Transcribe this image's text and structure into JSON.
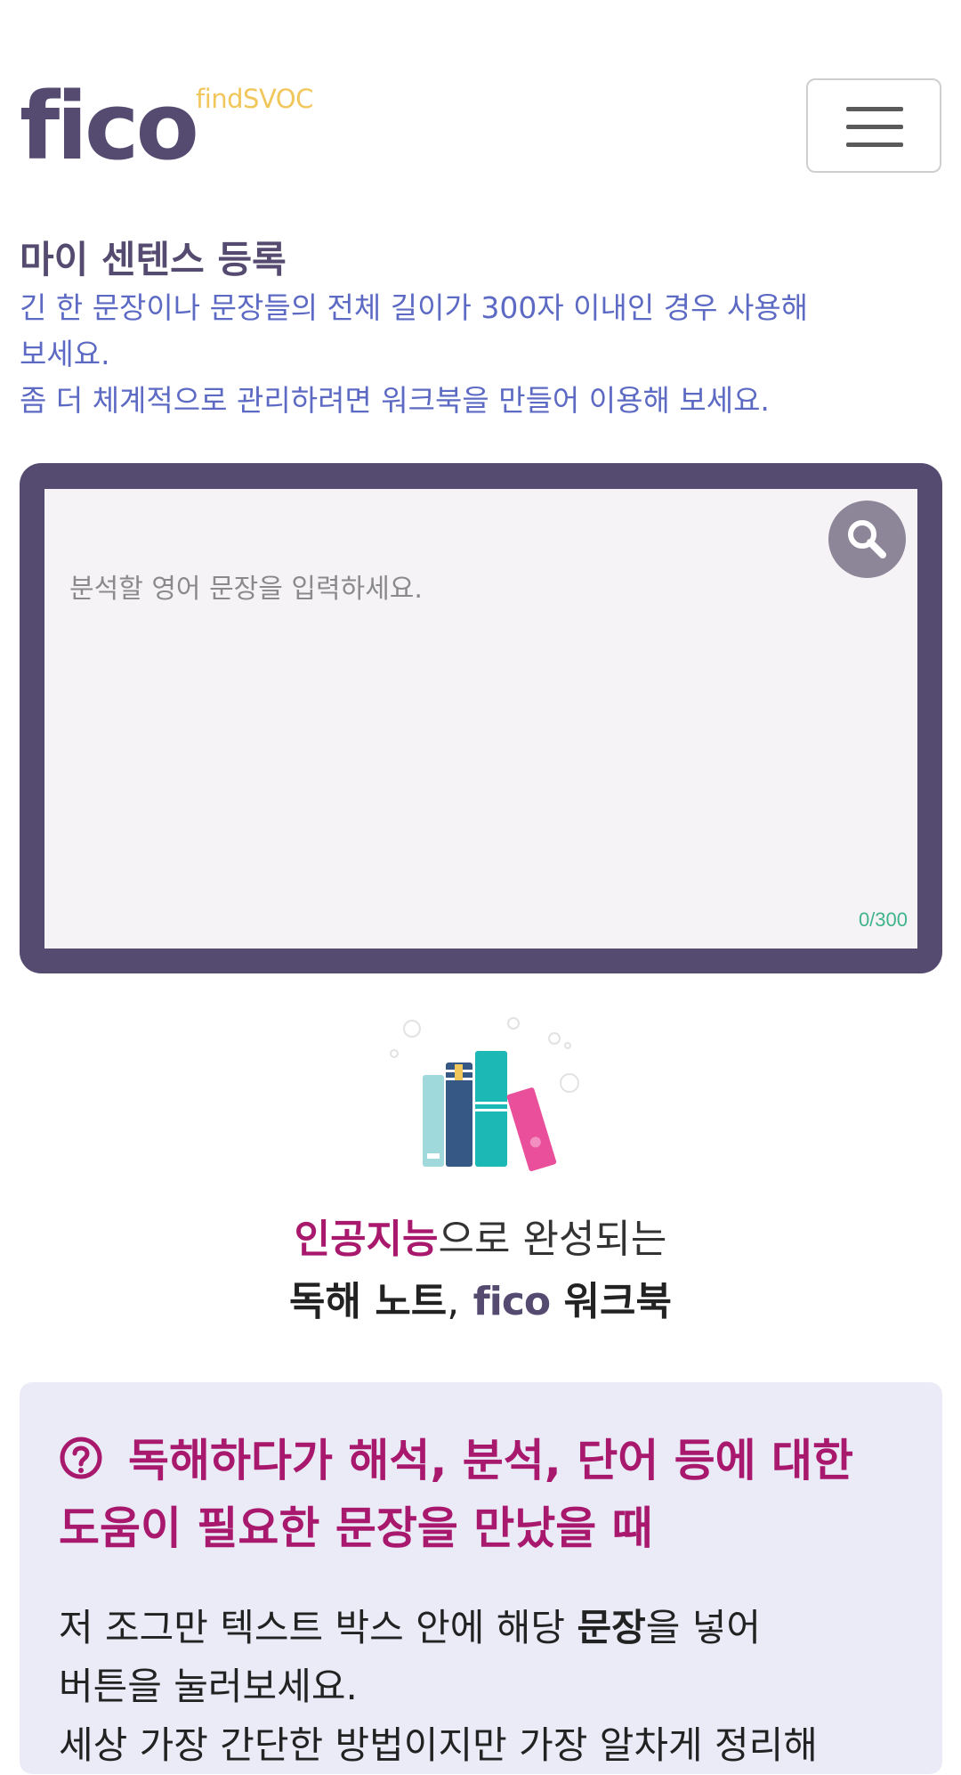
{
  "header": {
    "logo_text": "fico",
    "logo_sub": "findSVOC",
    "menu_button": "menu"
  },
  "intro": {
    "title": "마이 센텐스 등록",
    "desc_line1": "긴 한 문장이나 문장들의 전체 길이가 300자 이내인 경우 사용해",
    "desc_line2": "보세요.",
    "desc_line3": "좀 더 체계적으로 관리하려면 워크북을 만들어 이용해 보세요."
  },
  "editor": {
    "placeholder": "분석할 영어 문장을 입력하세요.",
    "value": "",
    "counter": "0/300"
  },
  "promo": {
    "highlight": "인공지능",
    "line1_rest": "으로 완성되는",
    "line2_a": "독해 노트",
    "line2_comma": ",",
    "line2_brand": "fico",
    "line2_b": "워크북"
  },
  "info": {
    "title_line1": "독해하다가 해석, 분석, 단어 등에 대한",
    "title_line2": "도움이 필요한 문장을 만났을 때",
    "body_a": "저 조그만 텍스트 박스 안에 해당 ",
    "body_bold": "문장",
    "body_b": "을 넣어",
    "body_line2": "버튼을 눌러보세요.",
    "body_line3": "세상 가장 간단한 방법이지만 가장 알차게 정리해"
  },
  "colors": {
    "brand": "#554b70",
    "accent_yellow": "#f1c75c",
    "desc_blue": "#5c6ac4",
    "magenta": "#a8196e",
    "counter_green": "#3fb38a",
    "info_bg": "#ebebf8"
  },
  "icons": [
    "menu-icon",
    "search-icon",
    "books-illustration",
    "question-circle-icon"
  ]
}
